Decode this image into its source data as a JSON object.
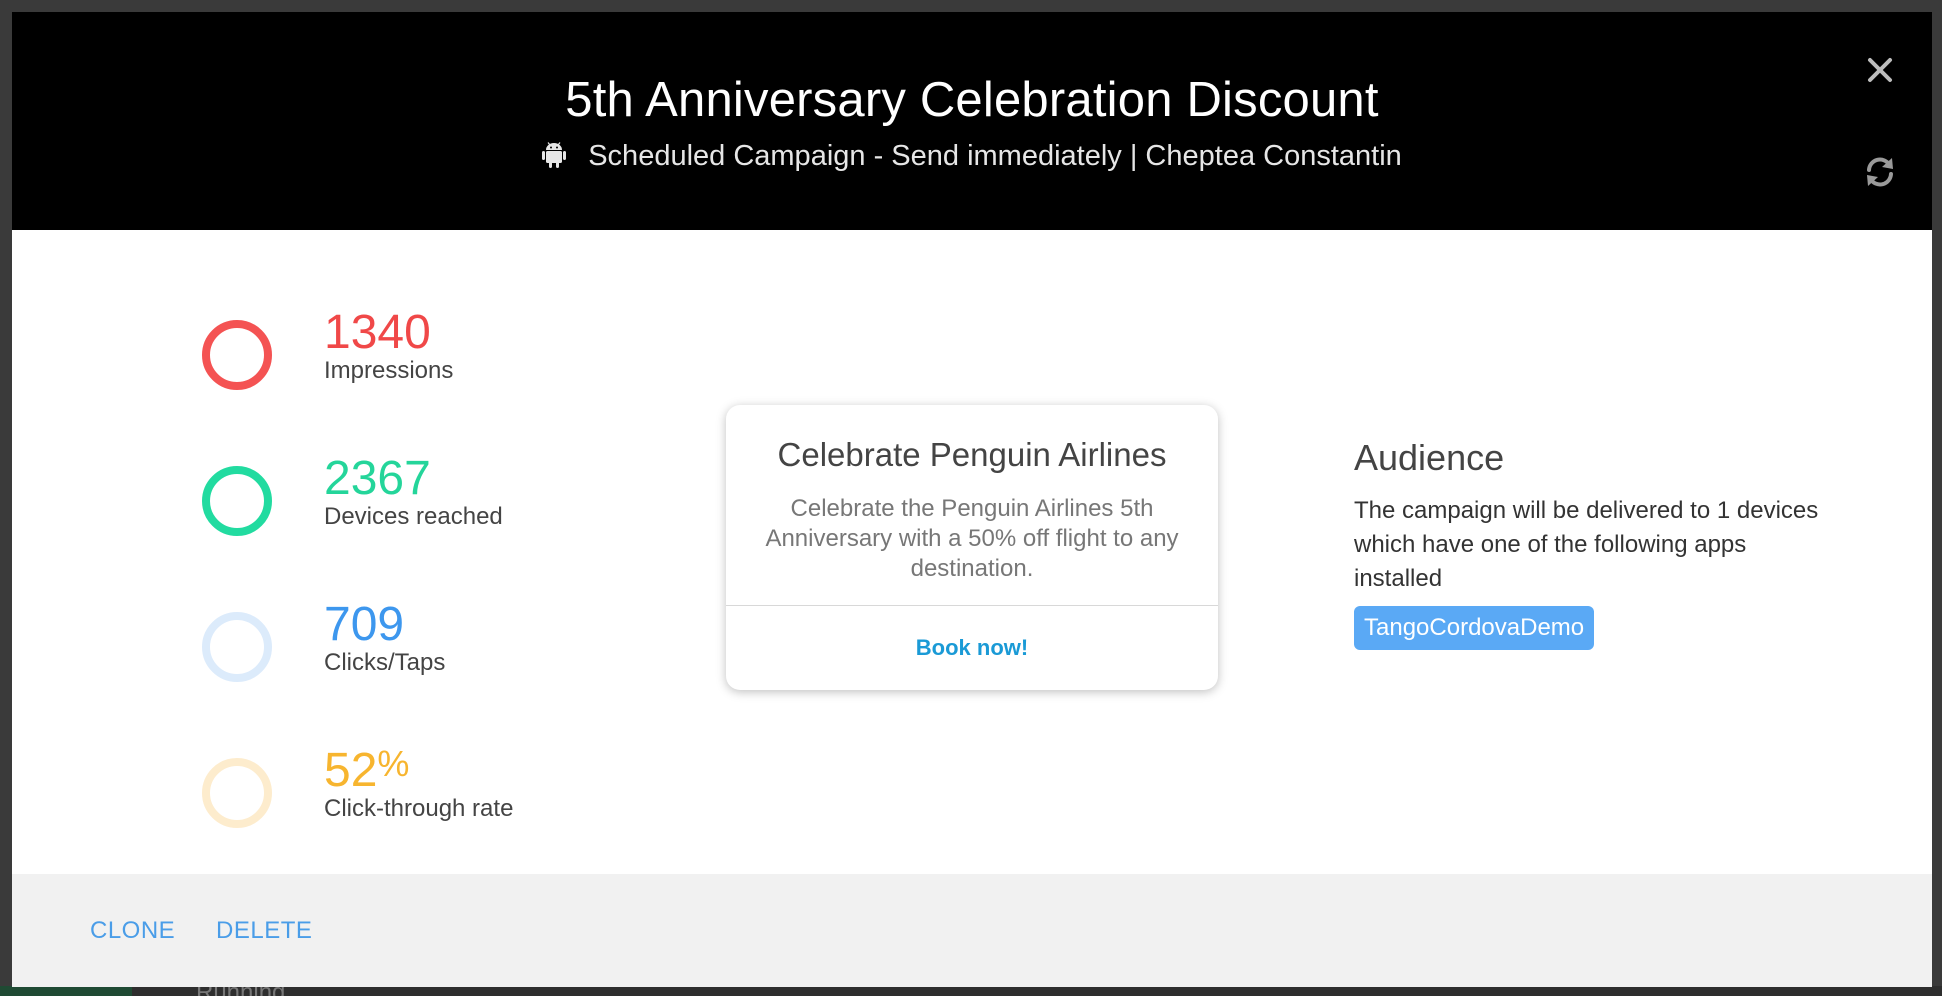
{
  "backdrop": {
    "peek_text": "Running"
  },
  "header": {
    "title": "5th Anniversary Celebration Discount",
    "subtitle": "Scheduled Campaign - Send immediately | Cheptea Constantin",
    "platform_icon": "android-icon",
    "close_icon": "close-icon",
    "refresh_icon": "refresh-icon"
  },
  "stats": [
    {
      "value": "1340",
      "unit": "",
      "label": "Impressions",
      "color": "#f04848",
      "ring_color": "#f45353"
    },
    {
      "value": "2367",
      "unit": "",
      "label": "Devices reached",
      "color": "#24d59a",
      "ring_color": "#22dba0"
    },
    {
      "value": "709",
      "unit": "",
      "label": "Clicks/Taps",
      "color": "#3d97ee",
      "ring_color": "#dcebfb"
    },
    {
      "value": "52",
      "unit": "%",
      "label": "Click-through rate",
      "color": "#f7b52f",
      "ring_color": "#fdeccd"
    }
  ],
  "preview": {
    "title": "Celebrate Penguin Airlines",
    "body": "Celebrate the Penguin Airlines 5th Anniversary with a 50% off flight to any destination.",
    "cta": "Book now!"
  },
  "audience": {
    "title": "Audience",
    "description": "The campaign will be delivered to 1 devices which have one of the following apps installed",
    "apps": [
      "TangoCordovaDemo"
    ]
  },
  "footer": {
    "clone_label": "CLONE",
    "delete_label": "DELETE"
  }
}
